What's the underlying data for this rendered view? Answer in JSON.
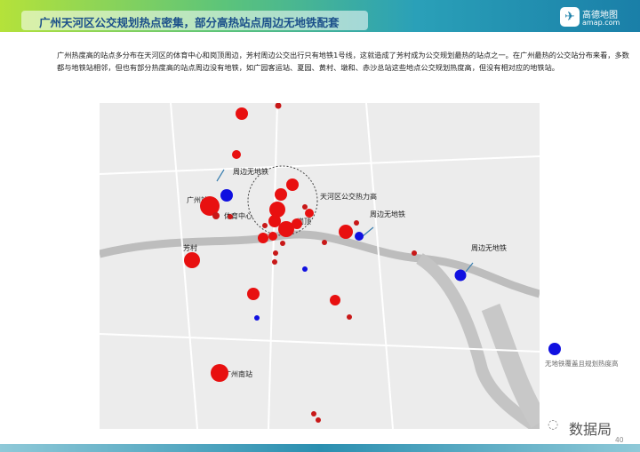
{
  "header": {
    "title": "广州天河区公交规划热点密集，部分高热站点周边无地铁配套",
    "logo_name": "高德地图",
    "logo_url": "amap.com"
  },
  "intro": "广州热度高的站点多分布在天河区的体育中心和岗顶周边，芳村周边公交出行只有地铁1号线，这就造成了芳村成为公交规划最热的站点之一。在广州最热的公交站分布来看，多数都与地铁站相邻，但也有部分热度高的站点周边没有地铁，如广园客运站、夏园、黄村、墩和、赤沙总站这些地点公交规划热度高，但没有相对应的地铁站。",
  "map": {
    "labels": {
      "guangzhou_station": "广州站",
      "fangcun": "芳村",
      "tiyu": "体育中心",
      "gangding": "岗顶",
      "tianhe": "天河区公交热力高",
      "nosubway": "周边无地铁",
      "south_station": "广州南站"
    },
    "colors": {
      "hot": "#e81010",
      "hot_dark": "#c81818",
      "no_subway": "#1010e0"
    }
  },
  "legend": {
    "text": "无地铁覆盖且规划热度高"
  },
  "watermark": "数据局",
  "page_number": "40"
}
